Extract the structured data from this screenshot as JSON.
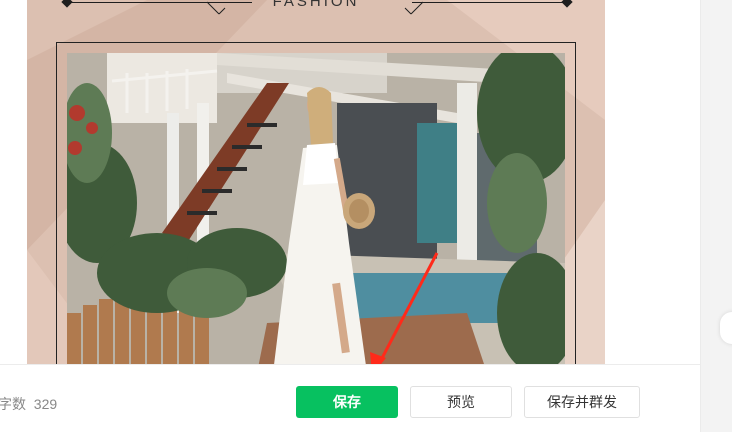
{
  "canvas": {
    "brand_text": "FASHION",
    "background_color": "#dcc0b1",
    "accent_color": "#c9a795"
  },
  "photo": {
    "subject": "woman-in-white-dress"
  },
  "annotation": {
    "arrow_color": "#ff2a1a"
  },
  "toolbar": {
    "word_count_label": "字数",
    "word_count_value": "329",
    "save_label": "保存",
    "preview_label": "预览",
    "save_publish_label": "保存并群发",
    "save_color": "#07c160"
  }
}
